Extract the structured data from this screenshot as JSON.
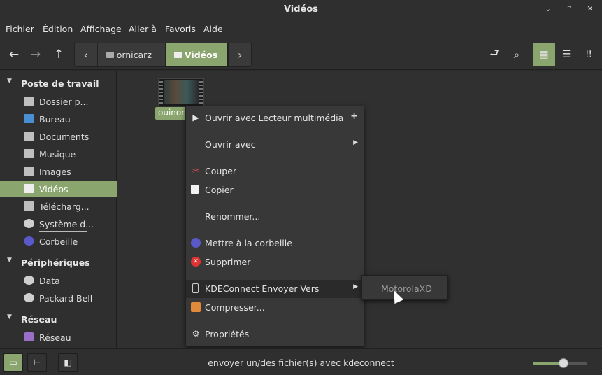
{
  "window": {
    "title": "Vidéos"
  },
  "menubar": [
    "Fichier",
    "Édition",
    "Affichage",
    "Aller à",
    "Favoris",
    "Aide"
  ],
  "breadcrumb": {
    "items": [
      "ornicarz",
      "Vidéos"
    ],
    "active": "Vidéos"
  },
  "sidebar": {
    "sections": [
      {
        "label": "Poste de travail",
        "items": [
          "Dossier p...",
          "Bureau",
          "Documents",
          "Musique",
          "Images",
          "Vidéos",
          "Télécharg...",
          "Système d...",
          "Corbeille"
        ]
      },
      {
        "label": "Périphériques",
        "items": [
          "Data",
          "Packard Bell"
        ]
      },
      {
        "label": "Réseau",
        "items": [
          "Réseau"
        ]
      }
    ],
    "selected": "Vidéos"
  },
  "file": {
    "name": "ouinon"
  },
  "context_menu": [
    "Ouvrir avec Lecteur multimédia",
    "Ouvrir avec",
    "Couper",
    "Copier",
    "Renommer...",
    "Mettre à la corbeille",
    "Supprimer",
    "KDEConnect Envoyer Vers",
    "Compresser...",
    "Propriétés"
  ],
  "submenu": [
    "MotorolaXD"
  ],
  "statusbar": {
    "text": "envoyer un/des fichier(s) avec kdeconnect",
    "zoom": 0.57
  },
  "colors": {
    "accent": "#8aa56d"
  }
}
